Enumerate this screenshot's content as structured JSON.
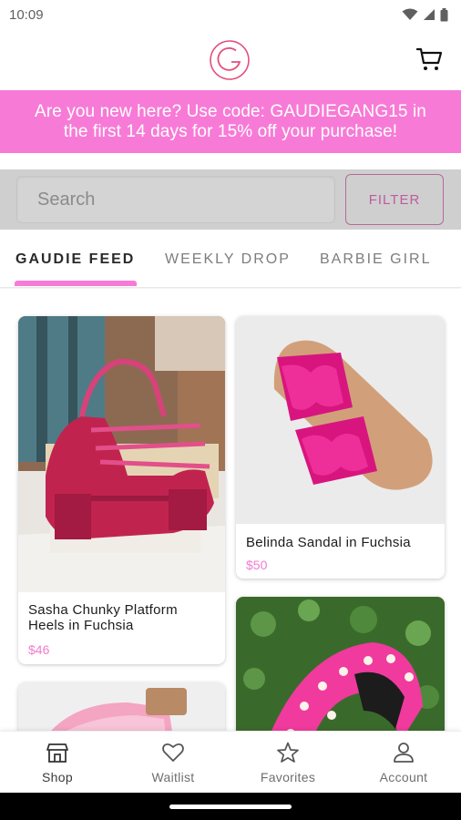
{
  "status_bar": {
    "time": "10:09"
  },
  "promo": {
    "text_line1": "Are you new here? Use code: GAUDIEGANG15 in",
    "text_line2": "the first 14 days for 15% off your purchase!"
  },
  "search": {
    "placeholder": "Search",
    "filter_label": "FILTER"
  },
  "tabs": [
    {
      "label": "GAUDIE FEED",
      "active": true
    },
    {
      "label": "WEEKLY DROP",
      "active": false
    },
    {
      "label": "BARBIE GIRL",
      "active": false
    }
  ],
  "products": [
    {
      "title_line1": "Sasha Chunky Platform",
      "title_line2": "Heels in Fuchsia",
      "price": "$46"
    },
    {
      "title_line1": "Belinda Sandal in Fuchsia",
      "title_line2": "",
      "price": "$50"
    },
    {
      "title_line1": "",
      "title_line2": "",
      "price": ""
    },
    {
      "title_line1": "",
      "title_line2": "",
      "price": ""
    }
  ],
  "bottom_nav": [
    {
      "label": "Shop",
      "icon": "shop-icon",
      "active": true
    },
    {
      "label": "Waitlist",
      "icon": "heart-icon",
      "active": false
    },
    {
      "label": "Favorites",
      "icon": "star-icon",
      "active": false
    },
    {
      "label": "Account",
      "icon": "person-icon",
      "active": false
    }
  ],
  "colors": {
    "brand_pink": "#f77bd6",
    "price_pink": "#f27bcf",
    "filter_border": "#b8679b"
  }
}
